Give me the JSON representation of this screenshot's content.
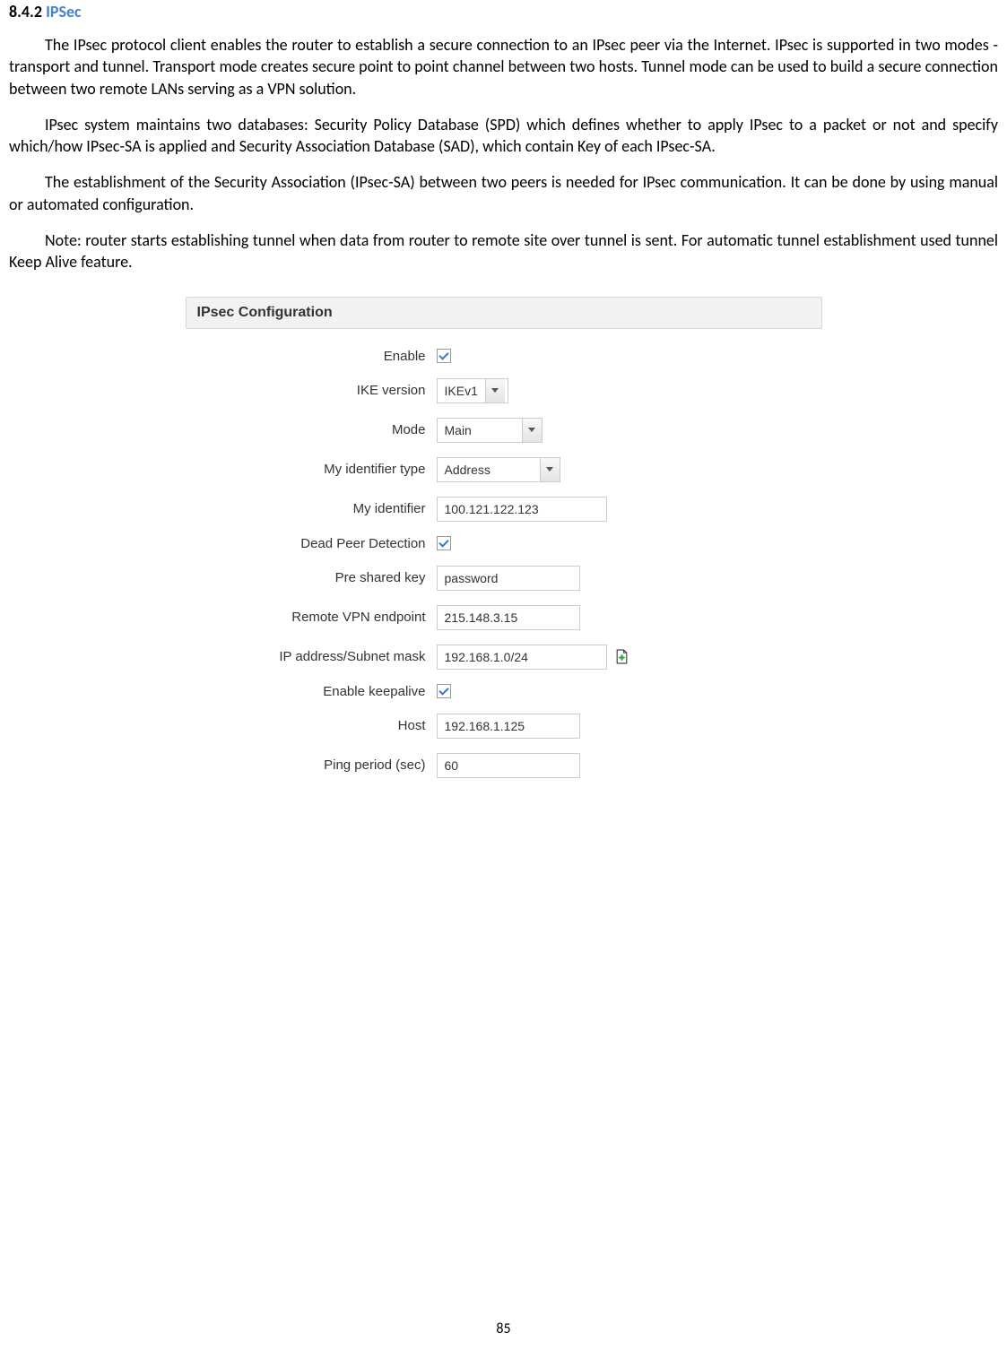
{
  "heading": {
    "number": "8.4.2",
    "title": "IPSec"
  },
  "paragraphs": {
    "p1": "The IPsec protocol client enables the router to establish a secure connection to an IPsec peer via the Internet. IPsec is supported in two modes - transport and tunnel. Transport mode creates secure point to point channel between two hosts. Tunnel mode can be used to build a secure connection between two remote LANs serving as a VPN solution.",
    "p2": "IPsec system maintains two databases: Security Policy Database (SPD) which defines whether to apply IPsec to a packet or not and specify which/how IPsec-SA is applied and Security Association Database (SAD), which contain Key of each IPsec-SA.",
    "p3": "The establishment of the Security Association (IPsec-SA) between two peers is needed for IPsec communication. It can be done by using manual or automated configuration.",
    "p4": "Note: router starts establishing tunnel when data from router to remote site over tunnel is sent. For automatic tunnel establishment used tunnel Keep Alive feature."
  },
  "config": {
    "panel_title": "IPsec Configuration",
    "labels": {
      "enable": "Enable",
      "ike_version": "IKE version",
      "mode": "Mode",
      "my_identifier_type": "My identifier type",
      "my_identifier": "My identifier",
      "dead_peer_detection": "Dead Peer Detection",
      "pre_shared_key": "Pre shared key",
      "remote_vpn_endpoint": "Remote VPN endpoint",
      "ip_address_subnet": "IP address/Subnet mask",
      "enable_keepalive": "Enable keepalive",
      "host": "Host",
      "ping_period": "Ping period (sec)"
    },
    "values": {
      "ike_version": "IKEv1",
      "mode": "Main",
      "my_identifier_type": "Address",
      "my_identifier": "100.121.122.123",
      "pre_shared_key": "password",
      "remote_vpn_endpoint": "215.148.3.15",
      "ip_address_subnet": "192.168.1.0/24",
      "host": "192.168.1.125",
      "ping_period": "60"
    }
  },
  "page_number": "85"
}
